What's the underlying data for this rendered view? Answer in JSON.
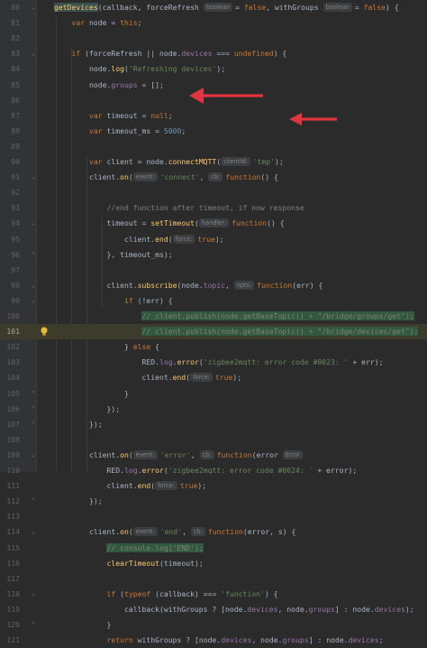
{
  "editor": {
    "colors": {
      "background": "#2b2b2b",
      "keyword": "#cc7832",
      "function": "#ffc66d",
      "property": "#9876aa",
      "string": "#6a8759",
      "number": "#6897bb",
      "comment": "#808080",
      "arrow": "#e0343e"
    },
    "lines": [
      {
        "n": "80",
        "tokens": [
          [
            "fn fnhl",
            "getDevices"
          ],
          [
            "",
            "(callback, forceRefresh "
          ],
          [
            "hint",
            "boolean"
          ],
          [
            "",
            "= "
          ],
          [
            "kw",
            "false"
          ],
          [
            "",
            ", withGroups "
          ],
          [
            "hint",
            "boolean"
          ],
          [
            "",
            "= "
          ],
          [
            "kw",
            "false"
          ],
          [
            "",
            ") {"
          ]
        ]
      },
      {
        "n": "81",
        "tokens": [
          [
            "",
            "    "
          ],
          [
            "kw",
            "var"
          ],
          [
            "",
            " node = "
          ],
          [
            "kw",
            "this"
          ],
          [
            "",
            ";"
          ]
        ]
      },
      {
        "n": "82",
        "tokens": []
      },
      {
        "n": "83",
        "tokens": [
          [
            "",
            "    "
          ],
          [
            "kw",
            "if"
          ],
          [
            "",
            " (forceRefresh || node."
          ],
          [
            "prop",
            "devices"
          ],
          [
            "",
            " === "
          ],
          [
            "kw",
            "undefined"
          ],
          [
            "",
            ") {"
          ]
        ]
      },
      {
        "n": "84",
        "tokens": [
          [
            "",
            "        node."
          ],
          [
            "fn",
            "log"
          ],
          [
            "",
            "("
          ],
          [
            "str",
            "'Refreshing devices'"
          ],
          [
            "",
            ");"
          ]
        ]
      },
      {
        "n": "85",
        "tokens": [
          [
            "",
            "        node."
          ],
          [
            "prop",
            "groups"
          ],
          [
            "",
            " = [];"
          ]
        ]
      },
      {
        "n": "86",
        "tokens": []
      },
      {
        "n": "87",
        "tokens": [
          [
            "",
            "        "
          ],
          [
            "kw",
            "var"
          ],
          [
            "",
            " timeout = "
          ],
          [
            "kw",
            "null"
          ],
          [
            "",
            ";"
          ]
        ]
      },
      {
        "n": "88",
        "tokens": [
          [
            "",
            "        "
          ],
          [
            "kw",
            "var"
          ],
          [
            "",
            " timeout_ms = "
          ],
          [
            "num",
            "5000"
          ],
          [
            "",
            ";"
          ]
        ]
      },
      {
        "n": "89",
        "tokens": []
      },
      {
        "n": "90",
        "tokens": [
          [
            "",
            "        "
          ],
          [
            "kw",
            "var"
          ],
          [
            "",
            " client = node."
          ],
          [
            "fn",
            "connectMQTT"
          ],
          [
            "",
            "("
          ],
          [
            "hint",
            "clientId:"
          ],
          [
            "str",
            "'tmp'"
          ],
          [
            "",
            ");"
          ]
        ]
      },
      {
        "n": "91",
        "tokens": [
          [
            "",
            "        client."
          ],
          [
            "fn",
            "on"
          ],
          [
            "",
            "("
          ],
          [
            "hint",
            "event:"
          ],
          [
            "str",
            "'connect'"
          ],
          [
            "",
            ", "
          ],
          [
            "hint",
            "cb:"
          ],
          [
            "kw",
            "function"
          ],
          [
            "",
            "() {"
          ]
        ]
      },
      {
        "n": "92",
        "tokens": []
      },
      {
        "n": "93",
        "tokens": [
          [
            "",
            "            "
          ],
          [
            "cmt",
            "//end function after timeout, if now response"
          ]
        ]
      },
      {
        "n": "94",
        "tokens": [
          [
            "",
            "            timeout = "
          ],
          [
            "fn",
            "setTimeout"
          ],
          [
            "",
            "("
          ],
          [
            "hint",
            "handler:"
          ],
          [
            "kw",
            "function"
          ],
          [
            "",
            "() {"
          ]
        ]
      },
      {
        "n": "95",
        "tokens": [
          [
            "",
            "                client."
          ],
          [
            "fn",
            "end"
          ],
          [
            "",
            "("
          ],
          [
            "hint",
            "force:"
          ],
          [
            "kw",
            "true"
          ],
          [
            "",
            ");"
          ]
        ]
      },
      {
        "n": "96",
        "tokens": [
          [
            "",
            "            }, timeout_ms);"
          ]
        ]
      },
      {
        "n": "97",
        "tokens": []
      },
      {
        "n": "98",
        "tokens": [
          [
            "",
            "            client."
          ],
          [
            "fn",
            "subscribe"
          ],
          [
            "",
            "(node."
          ],
          [
            "prop",
            "topic"
          ],
          [
            "",
            ", "
          ],
          [
            "hint",
            "opts:"
          ],
          [
            "kw",
            "function"
          ],
          [
            "",
            "(err) {"
          ]
        ]
      },
      {
        "n": "99",
        "tokens": [
          [
            "",
            "                "
          ],
          [
            "kw",
            "if"
          ],
          [
            "",
            " (!err) {"
          ]
        ]
      },
      {
        "n": "100",
        "tokens": [
          [
            "",
            "                    "
          ],
          [
            "cmt mark",
            "// client.publish(node.getBaseTopic() + \"/bridge/groups/get\");"
          ]
        ]
      },
      {
        "n": "101",
        "hl": true,
        "tokens": [
          [
            "",
            "                    "
          ],
          [
            "cmt mark",
            "// client.publish(node.getBaseTopic() + \"/bridge/devices/get\");"
          ]
        ]
      },
      {
        "n": "102",
        "tokens": [
          [
            "",
            "                } "
          ],
          [
            "kw",
            "else"
          ],
          [
            "",
            " {"
          ]
        ]
      },
      {
        "n": "103",
        "tokens": [
          [
            "",
            "                    RED."
          ],
          [
            "prop",
            "log"
          ],
          [
            "",
            "."
          ],
          [
            "fn",
            "error"
          ],
          [
            "",
            "("
          ],
          [
            "str",
            "'zigbee2mqtt: error code #0023: '"
          ],
          [
            "",
            " + err);"
          ]
        ]
      },
      {
        "n": "104",
        "tokens": [
          [
            "",
            "                    client."
          ],
          [
            "fn",
            "end"
          ],
          [
            "",
            "("
          ],
          [
            "hint",
            "force:"
          ],
          [
            "kw",
            "true"
          ],
          [
            "",
            ");"
          ]
        ]
      },
      {
        "n": "105",
        "tokens": [
          [
            "",
            "                }"
          ]
        ]
      },
      {
        "n": "106",
        "tokens": [
          [
            "",
            "            });"
          ]
        ]
      },
      {
        "n": "107",
        "tokens": [
          [
            "",
            "        });"
          ]
        ]
      },
      {
        "n": "108",
        "tokens": []
      },
      {
        "n": "109",
        "tokens": [
          [
            "",
            "        client."
          ],
          [
            "fn",
            "on"
          ],
          [
            "",
            "("
          ],
          [
            "hint",
            "event:"
          ],
          [
            "str",
            "'error'"
          ],
          [
            "",
            ", "
          ],
          [
            "hint",
            "cb:"
          ],
          [
            "kw",
            "function"
          ],
          [
            "",
            "(error "
          ],
          [
            "hint",
            "Error"
          ],
          [
            ") {"
          ]
        ]
      },
      {
        "n": "110",
        "tokens": [
          [
            "",
            "            RED."
          ],
          [
            "prop",
            "log"
          ],
          [
            "",
            "."
          ],
          [
            "fn",
            "error"
          ],
          [
            "",
            "("
          ],
          [
            "str",
            "'zigbee2mqtt: error code #0024: '"
          ],
          [
            "",
            " + error);"
          ]
        ]
      },
      {
        "n": "111",
        "tokens": [
          [
            "",
            "            client."
          ],
          [
            "fn",
            "end"
          ],
          [
            "",
            "("
          ],
          [
            "hint",
            "force:"
          ],
          [
            "kw",
            "true"
          ],
          [
            "",
            ");"
          ]
        ]
      },
      {
        "n": "112",
        "tokens": [
          [
            "",
            "        });"
          ]
        ]
      },
      {
        "n": "113",
        "tokens": []
      },
      {
        "n": "114",
        "tokens": [
          [
            "",
            "        client."
          ],
          [
            "fn",
            "on"
          ],
          [
            "",
            "("
          ],
          [
            "hint",
            "event:"
          ],
          [
            "str",
            "'end'"
          ],
          [
            "",
            ", "
          ],
          [
            "hint",
            "cb:"
          ],
          [
            "kw",
            "function"
          ],
          [
            "",
            "(error, s) {"
          ]
        ]
      },
      {
        "n": "115",
        "tokens": [
          [
            "",
            "            "
          ],
          [
            "cmt mark",
            "// console.log('END');"
          ]
        ]
      },
      {
        "n": "116",
        "tokens": [
          [
            "",
            "            "
          ],
          [
            "fn",
            "clearTimeout"
          ],
          [
            "",
            "(timeout);"
          ]
        ]
      },
      {
        "n": "117",
        "tokens": []
      },
      {
        "n": "118",
        "tokens": [
          [
            "",
            "            "
          ],
          [
            "kw",
            "if"
          ],
          [
            "",
            " ("
          ],
          [
            "kw",
            "typeof"
          ],
          [
            "",
            " (callback) === "
          ],
          [
            "str",
            "'function'"
          ],
          [
            "",
            ") {"
          ]
        ]
      },
      {
        "n": "119",
        "tokens": [
          [
            "",
            "                callback(withGroups ? [node."
          ],
          [
            "prop",
            "devices"
          ],
          [
            "",
            ", node."
          ],
          [
            "prop",
            "groups"
          ],
          [
            "",
            "] : node."
          ],
          [
            "prop",
            "devices"
          ],
          [
            "",
            ");"
          ]
        ]
      },
      {
        "n": "120",
        "tokens": [
          [
            "",
            "            } "
          ]
        ]
      },
      {
        "n": "121",
        "tokens": [
          [
            "",
            "            "
          ],
          [
            "kw",
            "return"
          ],
          [
            "",
            " withGroups ? [node."
          ],
          [
            "prop",
            "devices"
          ],
          [
            "",
            ", node."
          ],
          [
            "prop",
            "groups"
          ],
          [
            "",
            "] : node."
          ],
          [
            "prop",
            "devices"
          ],
          [
            "",
            ";"
          ]
        ]
      }
    ]
  }
}
